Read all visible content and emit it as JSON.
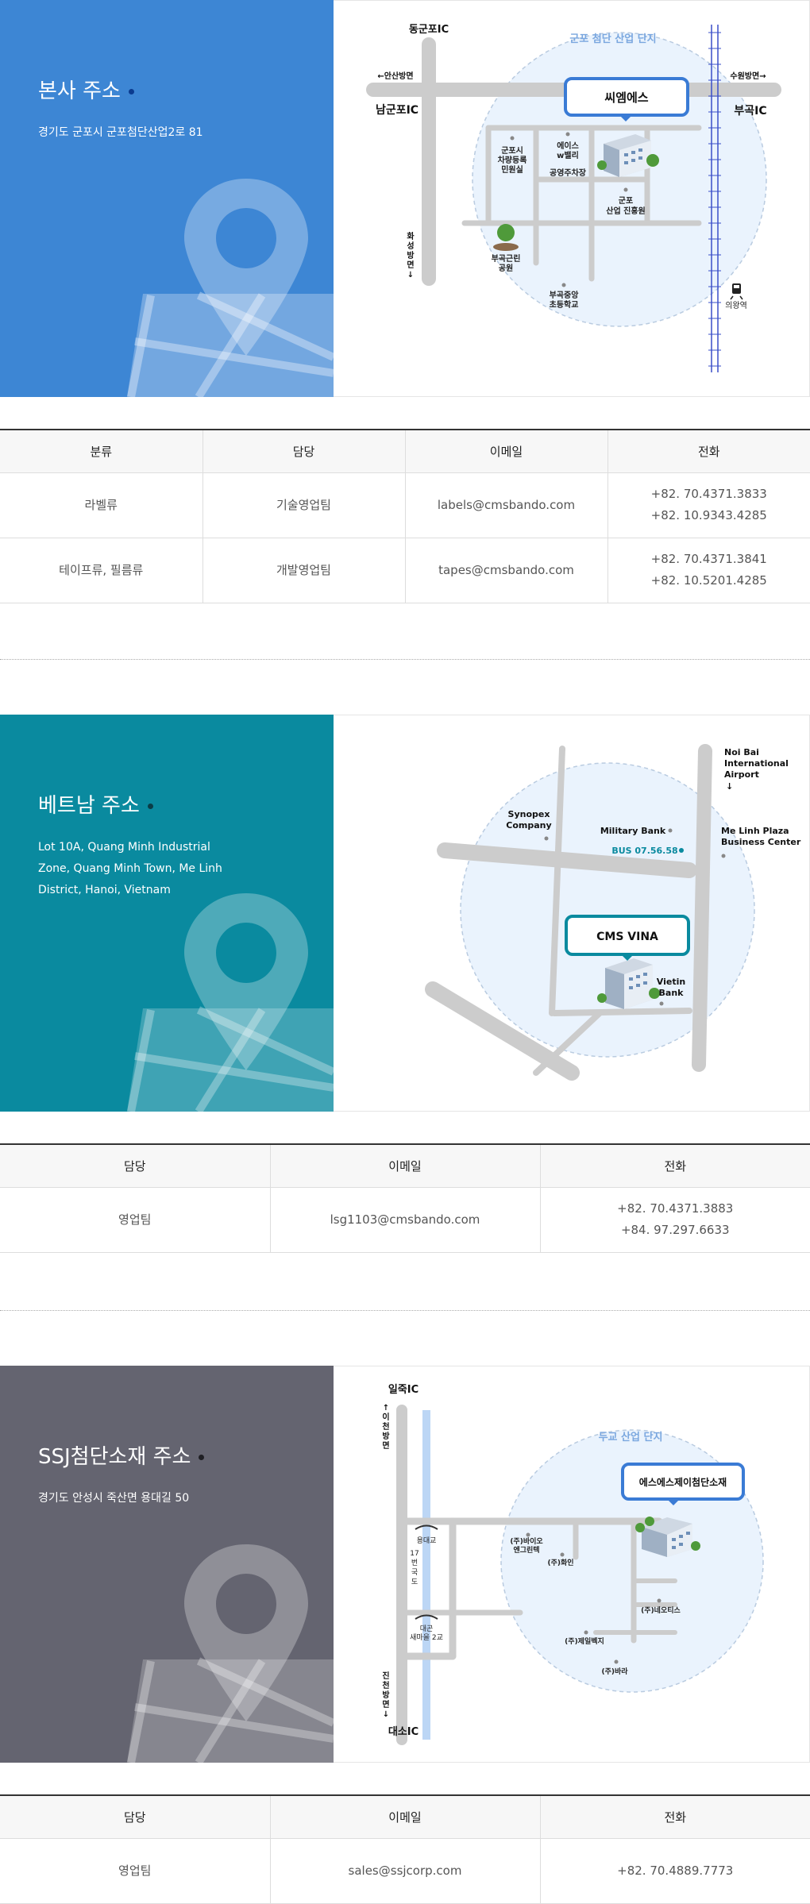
{
  "hq": {
    "title": "본사 주소",
    "address": "경기도 군포시 군포첨단산업2로 81",
    "color": "#3d86d4",
    "dot_color": "#0b3b8f",
    "map": {
      "zone_label": "군포 첨단 산업 단지",
      "ic_top": "동군포IC",
      "ic_left": "남군포IC",
      "ic_right": "부곡IC",
      "dir_left": "←안산방면",
      "dir_right": "수원방면→",
      "dir_down_chars": [
        "화",
        "성",
        "방",
        "면",
        "↓"
      ],
      "company": "씨엠에스",
      "poi_1_line1": "군포시",
      "poi_1_line2": "차량등록",
      "poi_1_line3": "민원실",
      "poi_2_line1": "에이스",
      "poi_2_line2": "w밸리",
      "poi_3": "공영주차장",
      "poi_4_line1": "군포",
      "poi_4_line2": "산업 진흥원",
      "poi_5_line1": "부곡근린",
      "poi_5_line2": "공원",
      "poi_6_line1": "부곡중앙",
      "poi_6_line2": "초등학교",
      "station": "의왕역"
    }
  },
  "hq_table": {
    "headers": [
      "분류",
      "담당",
      "이메일",
      "전화"
    ],
    "rows": [
      {
        "category": "라벨류",
        "team": "기술영업팀",
        "email": "labels@cmsbando.com",
        "phone1": "+82. 70.4371.3833",
        "phone2": "+82. 10.9343.4285"
      },
      {
        "category": "테이프류, 필름류",
        "team": "개발영업팀",
        "email": "tapes@cmsbando.com",
        "phone1": "+82. 70.4371.3841",
        "phone2": "+82. 10.5201.4285"
      }
    ]
  },
  "vn": {
    "title": "베트남 주소",
    "address": "Lot 10A, Quang Minh Industrial Zone, Quang Minh Town, Me Linh District, Hanoi, Vietnam",
    "color": "#0a8a9f",
    "dot_color": "#0a3d47",
    "map": {
      "airport_1": "Noi Bai",
      "airport_2": "International",
      "airport_3": "Airport",
      "airport_arrow": "↓",
      "synopex_1": "Synopex",
      "synopex_2": "Company",
      "military": "Military Bank",
      "bus": "BUS 07.56.58",
      "plaza_1": "Me Linh Plaza",
      "plaza_2": "Business Center",
      "company": "CMS VINA",
      "vietin_1": "Vietin",
      "vietin_2": "Bank",
      "accent": "#0a8a9f"
    }
  },
  "vn_table": {
    "headers": [
      "담당",
      "이메일",
      "전화"
    ],
    "rows": [
      {
        "team": "영업팀",
        "email": "lsg1103@cmsbando.com",
        "phone1": "+82. 70.4371.3883",
        "phone2": "+84. 97.297.6633"
      }
    ]
  },
  "ssj": {
    "title": "SSJ첨단소재 주소",
    "address": "경기도 안성시 죽산면 용대길 50",
    "color": "#646470",
    "dot_color": "#1f1f24",
    "map": {
      "ic_top": "일죽IC",
      "ic_bottom": "대소IC",
      "dir_up_chars": [
        "↑",
        "이",
        "천",
        "방",
        "면"
      ],
      "dir_down_chars": [
        "진",
        "천",
        "방",
        "면",
        "↓"
      ],
      "route_chars": [
        "17",
        "번",
        "국",
        "도"
      ],
      "bridge_1": "용대교",
      "bridge_2_line1": "대곤",
      "bridge_2_line2": "새마을 2교",
      "zone_label": "두교 산업 단지",
      "company": "에스에스제이첨단소재",
      "poi_1_line1": "(주)바이오",
      "poi_1_line2": "엔그린텍",
      "poi_2": "(주)화인",
      "poi_3": "(주)네오티스",
      "poi_4": "(주)제일벡지",
      "poi_5": "(주)바라"
    }
  },
  "ssj_table": {
    "headers": [
      "담당",
      "이메일",
      "전화"
    ],
    "rows": [
      {
        "team": "영업팀",
        "email": "sales@ssjcorp.com",
        "phone1": "+82. 70.4889.7773"
      }
    ]
  },
  "colors": {
    "map_blue": "#3a7bd5",
    "circle_fill": "#eaf3fd",
    "road": "#cccccc"
  }
}
